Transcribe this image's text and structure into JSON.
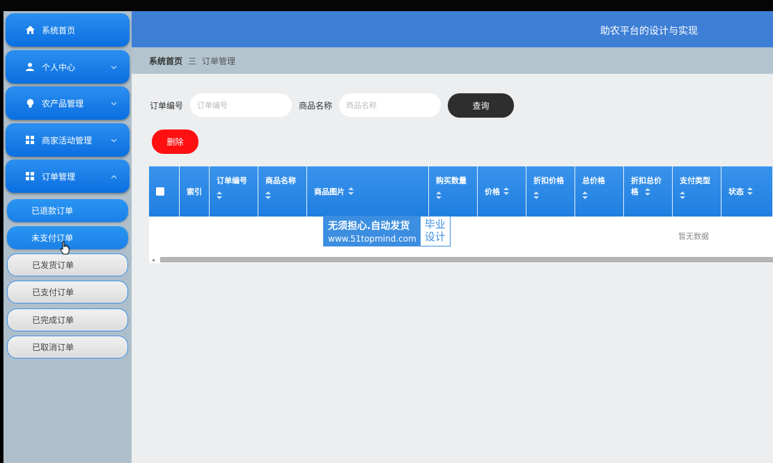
{
  "header": {
    "title": "助农平台的设计与实现"
  },
  "sidebar": {
    "items": [
      {
        "label": "系统首页",
        "icon": "home-icon"
      },
      {
        "label": "个人中心",
        "icon": "user-icon"
      },
      {
        "label": "农产品管理",
        "icon": "bulb-icon"
      },
      {
        "label": "商家活动管理",
        "icon": "grid-icon"
      },
      {
        "label": "订单管理",
        "icon": "grid-icon"
      }
    ],
    "sub_items": [
      {
        "label": "已退款订单"
      },
      {
        "label": "未支付订单"
      },
      {
        "label": "已发货订单"
      },
      {
        "label": "已支付订单"
      },
      {
        "label": "已完成订单"
      },
      {
        "label": "已取消订单"
      }
    ]
  },
  "breadcrumb": {
    "home": "系统首页",
    "sep": "三",
    "current": "订单管理"
  },
  "search": {
    "order_no_label": "订单编号",
    "order_no_placeholder": "订单编号",
    "product_name_label": "商品名称",
    "product_name_placeholder": "商品名称",
    "query_label": "查询"
  },
  "actions": {
    "delete_label": "删除"
  },
  "table": {
    "columns": [
      "索引",
      "订单编号",
      "商品名称",
      "商品图片",
      "购买数量",
      "价格",
      "折扣价格",
      "总价格",
      "折扣总价格",
      "支付类型",
      "状态"
    ],
    "empty_text": "暂无数据"
  },
  "watermark": {
    "line1": "无须担心.自动发货",
    "line2": "www.51topmind.com",
    "right1": "毕业",
    "right2": "设计"
  },
  "colors": {
    "header": "#3e7fd6",
    "nav": "#0a6fe0",
    "delete": "#ff1010",
    "query": "#2e2e2e"
  }
}
